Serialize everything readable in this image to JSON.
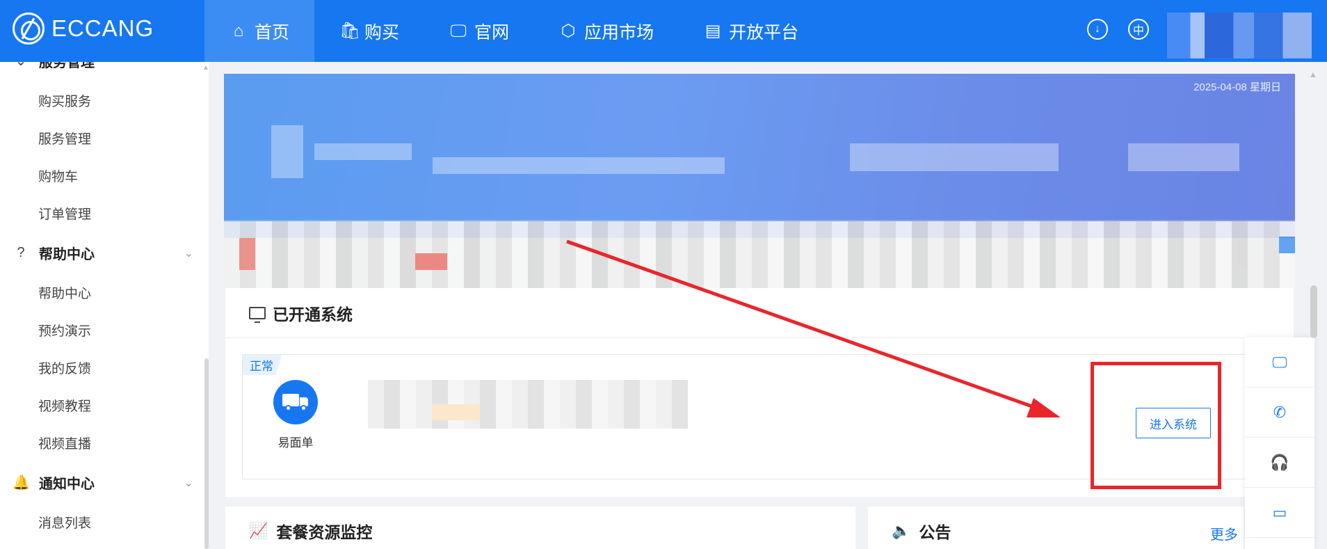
{
  "brand": {
    "name": "ECCANG"
  },
  "nav": [
    {
      "label": "首页",
      "icon": "⌂"
    },
    {
      "label": "购买",
      "icon": "🛍"
    },
    {
      "label": "官网",
      "icon": "🖵"
    },
    {
      "label": "应用市场",
      "icon": "⬡"
    },
    {
      "label": "开放平台",
      "icon": "▤"
    }
  ],
  "topbar": {
    "download_icon": "↓",
    "lang_label": "中"
  },
  "sidebar": {
    "groups": [
      {
        "label": "服务管理",
        "icon": "⌄",
        "items": [
          "购买服务",
          "服务管理",
          "购物车",
          "订单管理"
        ]
      },
      {
        "label": "帮助中心",
        "icon": "?",
        "items": [
          "帮助中心",
          "预约演示",
          "我的反馈",
          "视频教程",
          "视频直播"
        ]
      },
      {
        "label": "通知中心",
        "icon": "🔔",
        "items": [
          "消息列表"
        ]
      }
    ],
    "chevron": "⌄"
  },
  "banner": {
    "date_text": "2025-04-08 星期日"
  },
  "opened_systems": {
    "title": "已开通系统",
    "card": {
      "status": "正常",
      "app_name": "易面单",
      "enter_label": "进入系统"
    }
  },
  "package_monitor": {
    "title": "套餐资源监控"
  },
  "announcement": {
    "title": "公告",
    "more_label": "更多"
  },
  "float_bar": [
    "🖵",
    "✆",
    "🎧",
    "▭"
  ],
  "colors": {
    "accent": "#1677f0",
    "highlight": "#e8262b"
  }
}
